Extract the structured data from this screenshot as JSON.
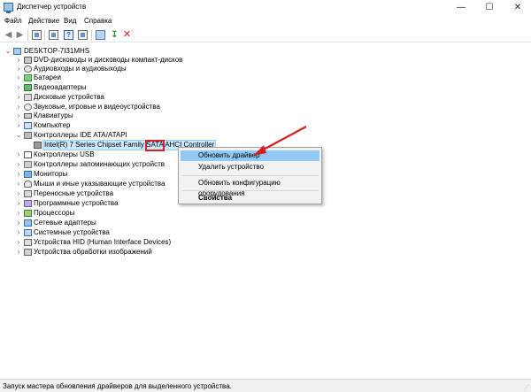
{
  "window": {
    "title": "Диспетчер устройств",
    "controls": {
      "minimize": "—",
      "maximize": "☐",
      "close": "✕"
    }
  },
  "menu": [
    "Файл",
    "Действие",
    "Вид",
    "Справка"
  ],
  "toolbar": {
    "icons": [
      "back-icon",
      "forward-icon",
      "properties-icon",
      "help-icon",
      "monitor-icon",
      "update-driver-icon",
      "delete-icon"
    ]
  },
  "tree": {
    "root": "DESKTOP-7I31MHS",
    "categories": [
      {
        "label": "DVD-дисководы и дисководы компакт-дисков",
        "icon": "disk"
      },
      {
        "label": "Аудиовходы и аудиовыходы",
        "icon": "audio"
      },
      {
        "label": "Батареи",
        "icon": "battery"
      },
      {
        "label": "Видеоадаптеры",
        "icon": "display"
      },
      {
        "label": "Дисковые устройства",
        "icon": "drive"
      },
      {
        "label": "Звуковые, игровые и видеоустройства",
        "icon": "sound"
      },
      {
        "label": "Клавиатуры",
        "icon": "keyboard"
      },
      {
        "label": "Компьютер",
        "icon": "pc"
      },
      {
        "label": "Контроллеры IDE ATA/ATAPI",
        "icon": "ide",
        "expanded": true
      },
      {
        "label": "Контроллеры USB",
        "icon": "usb"
      },
      {
        "label": "Контроллеры запоминающих устройств",
        "icon": "storage"
      },
      {
        "label": "Мониторы",
        "icon": "monitor"
      },
      {
        "label": "Мыши и иные указывающие устройства",
        "icon": "mouse"
      },
      {
        "label": "Переносные устройства",
        "icon": "portable"
      },
      {
        "label": "Программные устройства",
        "icon": "software"
      },
      {
        "label": "Процессоры",
        "icon": "cpu"
      },
      {
        "label": "Сетевые адаптеры",
        "icon": "network"
      },
      {
        "label": "Системные устройства",
        "icon": "system"
      },
      {
        "label": "Устройства HID (Human Interface Devices)",
        "icon": "hid"
      },
      {
        "label": "Устройства обработки изображений",
        "icon": "imaging"
      }
    ],
    "child_device": "Intel(R) 7 Series Chipset Family SATA AHCI Controller"
  },
  "context_menu": {
    "items": [
      "Обновить драйвер",
      "Удалить устройство",
      "Обновить конфигурацию оборудования",
      "Свойства"
    ],
    "highlight_color": "#90c8f6"
  },
  "annotation": {
    "color": "#d42020"
  },
  "status": "Запуск мастера обновления драйверов для выделенного устройства."
}
